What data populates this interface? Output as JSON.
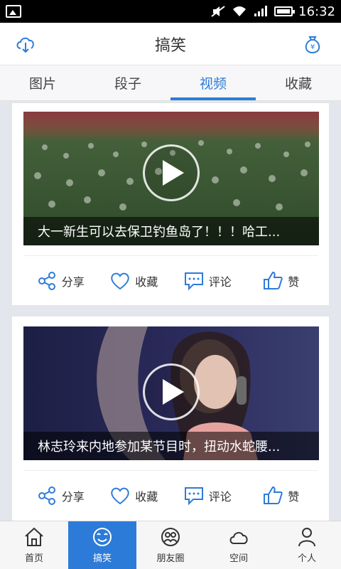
{
  "status": {
    "time": "16:32"
  },
  "header": {
    "title": "搞笑",
    "left_icon": "cloud-download-icon",
    "right_icon": "money-bag-icon"
  },
  "tabs": [
    {
      "label": "图片",
      "active": false
    },
    {
      "label": "段子",
      "active": false
    },
    {
      "label": "视频",
      "active": true
    },
    {
      "label": "收藏",
      "active": false
    }
  ],
  "cards": [
    {
      "caption": "大一新生可以去保卫钓鱼岛了！！！哈工..."
    },
    {
      "caption": "林志玲来内地参加某节目时，扭动水蛇腰..."
    }
  ],
  "actions": {
    "share": "分享",
    "favorite": "收藏",
    "comment": "评论",
    "like": "赞"
  },
  "bottom_nav": [
    {
      "label": "首页",
      "icon": "home-icon",
      "active": false
    },
    {
      "label": "搞笑",
      "icon": "smile-icon",
      "active": true
    },
    {
      "label": "朋友圈",
      "icon": "friends-icon",
      "active": false
    },
    {
      "label": "空间",
      "icon": "cloud-icon",
      "active": false
    },
    {
      "label": "个人",
      "icon": "person-icon",
      "active": false
    }
  ],
  "colors": {
    "accent": "#2d7bd8",
    "background": "#e3e6ec"
  }
}
